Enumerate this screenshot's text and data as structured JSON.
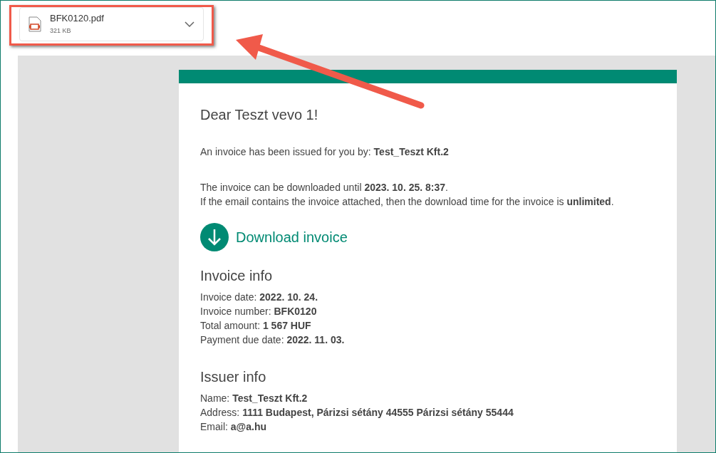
{
  "attachment": {
    "name": "BFK0120.pdf",
    "size": "321 KB"
  },
  "email": {
    "greeting": "Dear Teszt vevo 1!",
    "paragraphs": [
      [
        "An invoice has been issued for you by: **Test_Teszt Kft.2**"
      ],
      [
        "The invoice can be downloaded until **2023. 10. 25. 8:37**.",
        "If the email contains the invoice attached, then the download time for the invoice is **unlimited**."
      ]
    ],
    "download_label": "Download invoice",
    "sections": [
      {
        "title": "Invoice info",
        "lines": [
          "Invoice date: **2022. 10. 24.**",
          "Invoice number: **BFK0120**",
          "Total amount: **1 567 HUF**",
          "Payment due date: **2022. 11. 03.**"
        ]
      },
      {
        "title": "Issuer info",
        "lines": [
          "Name: **Test_Teszt Kft.2**",
          "Address: **1111 Budapest, Párizsi sétány 44555 Párizsi sétány 55444**",
          "Email: **a@a.hu**"
        ]
      }
    ]
  }
}
